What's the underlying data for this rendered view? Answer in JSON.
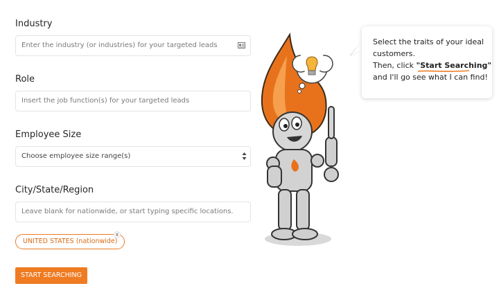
{
  "form": {
    "industry": {
      "label": "Industry",
      "placeholder": "Enter the industry (or industries) for your targeted leads"
    },
    "role": {
      "label": "Role",
      "placeholder": "Insert the job function(s) for your targeted leads"
    },
    "employee_size": {
      "label": "Employee Size",
      "selected": "Choose employee size range(s)"
    },
    "location": {
      "label": "City/State/Region",
      "placeholder": "Leave blank for nationwide, or start typing specific locations.",
      "tag": "UNITED STATES (nationwide)",
      "tag_remove": "x"
    },
    "submit_label": "START SEARCHING"
  },
  "bubble": {
    "line1": "Select the traits of your ideal",
    "line2": "customers.",
    "line3_prefix": "Then, click ",
    "line3_highlight": "\"Start Searching\"",
    "line4": "and I'll go see what I can find!"
  },
  "colors": {
    "accent": "#ef7b22",
    "tag_border": "#ec7a22",
    "field_border": "#e4e4e4"
  },
  "icons": {
    "industry_field": "card-icon",
    "select": "updown-arrows-icon",
    "mascot": "flame-robot-mascot",
    "thought": "lightbulb-icon"
  }
}
